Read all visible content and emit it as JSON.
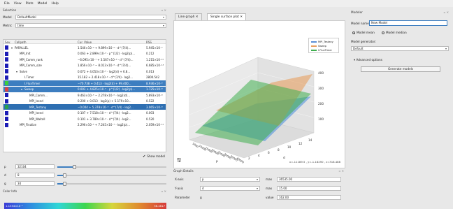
{
  "menu": [
    "File",
    "View",
    "Plots",
    "Model",
    "Help"
  ],
  "left": {
    "title": "Selection",
    "model_label": "Model",
    "model_value": "DefaultModel",
    "metric_label": "Metric",
    "metric_value": "time",
    "tree_headers": {
      "sev": "Sev.",
      "callpath": "Callpath",
      "value": "Cur. Value",
      "rss": "RSS"
    },
    "rows": [
      {
        "color": "#1b1bb5",
        "name": "PARALLEL",
        "indent": 0,
        "value": "1.546×10⁻⁴ + 9.899×10⁻⁵ · d^(7/4)...",
        "rss": "5.945×10⁻⁷",
        "prefix": "▾",
        "sel": ""
      },
      {
        "color": "#1b1bb5",
        "name": "MPI_Init",
        "indent": 1,
        "value": "0.063 + 2.899×10⁻³ · p^(1/2) · log2(p)...",
        "rss": "0.212",
        "prefix": "",
        "sel": ""
      },
      {
        "color": "#1b1bb5",
        "name": "MPI_Comm_rank",
        "indent": 1,
        "value": "−6.095×10⁻⁷ + 3.567×10⁻⁸ · d^(7/4)...",
        "rss": "1.215×10⁻¹⁰",
        "prefix": "",
        "sel": ""
      },
      {
        "color": "#1b1bb5",
        "name": "MPI_Comm_size",
        "indent": 1,
        "value": "1.856×10⁻⁶ − 8.013×10⁻⁸ · d^(7/4)...",
        "rss": "6.685×10⁻¹³",
        "prefix": "",
        "sel": ""
      },
      {
        "color": "#1b1bb5",
        "name": "Solve",
        "indent": 1,
        "value": "0.072 + 4.053×10⁻⁵ · log2(d) + 6.8...",
        "rss": "0.013",
        "prefix": "▾",
        "sel": ""
      },
      {
        "color": "#1b1bb5",
        "name": "I.Timer",
        "indent": 2,
        "value": "15.182 + 2.418×10⁻⁴ · d^(7/4) · log2...",
        "rss": "2800.542",
        "prefix": "",
        "sel": ""
      },
      {
        "color": "#3ccc3c",
        "name": "I.FluxTimer",
        "indent": 2,
        "value": "−70.738 + 0.413 · log2(d) + 99.400...",
        "rss": "8.936×10⁻⁹",
        "prefix": "",
        "sel": "sel"
      },
      {
        "color": "#e04040",
        "name": "Sweep",
        "indent": 2,
        "value": "0.003 + 4.825×10⁻⁶ · p^(1/2) · log2(p)...",
        "rss": "1.725×10⁻⁸",
        "prefix": "▾",
        "sel": "sel"
      },
      {
        "color": "#1b1bb5",
        "name": "MPI_Comm...",
        "indent": 3,
        "value": "9.463×10⁻⁵ − 2.278×10⁻⁶ · log2(d)...",
        "rss": "5.893×10⁻⁸",
        "prefix": "",
        "sel": ""
      },
      {
        "color": "#1b1bb5",
        "name": "MPI_Isend",
        "indent": 3,
        "value": "0.200 + 0.013 · log2(p) + 5.179×10...",
        "rss": "0.522",
        "prefix": "",
        "sel": ""
      },
      {
        "color": "#2a9e4f",
        "name": "MPI_Testany",
        "indent": 3,
        "value": "−0.004 + 5.378×10⁻⁵ · d^(7/4) · log2...",
        "rss": "3.065×10⁻⁸",
        "prefix": "",
        "sel": "sel2"
      },
      {
        "color": "#1b1bb5",
        "name": "MPI_Isend",
        "indent": 3,
        "value": "0.107 + 7.518×10⁻⁴ · d^(7/4) · log2...",
        "rss": "0.003",
        "prefix": "",
        "sel": ""
      },
      {
        "color": "#1b1bb5",
        "name": "MPI_Waitall",
        "indent": 3,
        "value": "0.101 + 3.789×10⁻⁴ · d^(7/4) · log2...",
        "rss": "0.520",
        "prefix": "",
        "sel": ""
      },
      {
        "color": "#1b1bb5",
        "name": "MPI_Finalize",
        "indent": 1,
        "value": "2.296×10⁻⁵ + 7.245×10⁻⁷ · log2(p)...",
        "rss": "2.059×10⁻¹²",
        "prefix": "",
        "sel": ""
      }
    ],
    "show_model_label": "Show model",
    "params": [
      {
        "name": "p",
        "value": "32104",
        "fill": 0.14
      },
      {
        "name": "d",
        "value": "8",
        "fill": 0.05
      },
      {
        "name": "g",
        "value": "34",
        "fill": 0.05
      }
    ],
    "color_info_title": "Color Info",
    "colorbar_min": "1.1354×10⁻⁷",
    "colorbar_max": "36.4617"
  },
  "center": {
    "tabs": [
      "Line graph",
      "Single surface plot"
    ],
    "legend": [
      {
        "label": "MPI_Testany",
        "color": "#5b8fd6"
      },
      {
        "label": "Sweep",
        "color": "#e8a060"
      },
      {
        "label": "I.FluxTimer",
        "color": "#3fae4f"
      }
    ],
    "chart_data": {
      "type": "surface",
      "series": [
        {
          "name": "MPI_Testany",
          "color": "#5b8fd6"
        },
        {
          "name": "Sweep",
          "color": "#e8a060"
        },
        {
          "name": "I.FluxTimer",
          "color": "#3fae4f"
        }
      ],
      "xlabel": "p",
      "ylabel": "d",
      "z_ticks": [
        100,
        200,
        300,
        400
      ],
      "x_ticks": [
        5000,
        10000,
        15000,
        20000,
        25000,
        30000,
        35000,
        40000
      ],
      "y_ticks": [
        2,
        4,
        6,
        8,
        10,
        12,
        14
      ]
    },
    "coord_readout": "x=-11189.5 , y=-1.18290 , z=318.488",
    "graph_ctrl_title": "Graph Details",
    "x_axis_label": "X-axis",
    "x_axis_value": "p",
    "y_axis_label": "Y-axis",
    "y_axis_value": "d",
    "max_label": "max",
    "max_x": "36535.00",
    "max_y": "15.00",
    "parameter_label": "Parameter",
    "parameter_value": "g",
    "value_label": "value",
    "parameter_num": "162.00"
  },
  "right": {
    "title": "Modeler",
    "model_name_label": "Model name:",
    "model_name_value": "New Model",
    "radio_mean": "Model mean",
    "radio_median": "Model median",
    "generator_label": "Model generator:",
    "generator_value": "Default",
    "advanced_label": "Advanced options",
    "generate_button": "Generate models"
  }
}
